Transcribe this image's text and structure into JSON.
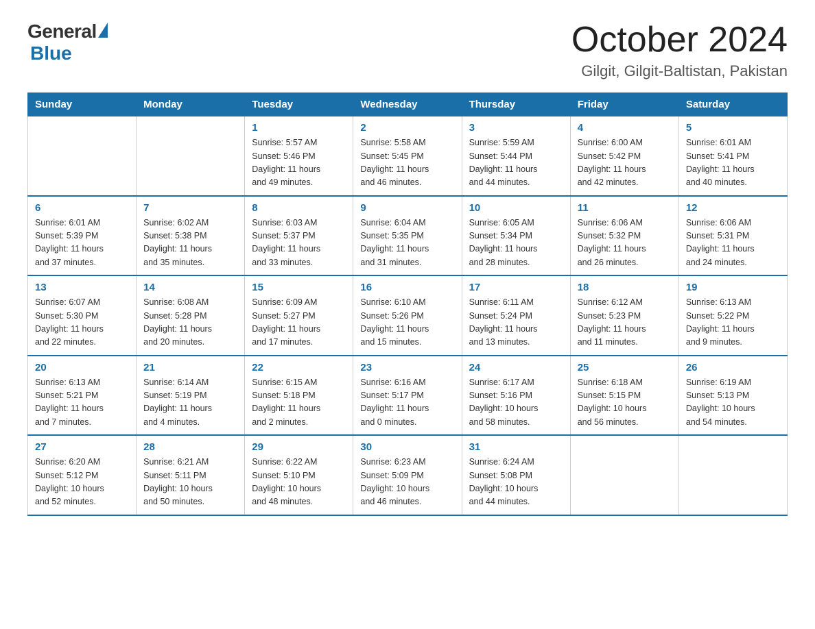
{
  "header": {
    "logo_general": "General",
    "logo_blue": "Blue",
    "month": "October 2024",
    "location": "Gilgit, Gilgit-Baltistan, Pakistan"
  },
  "days_of_week": [
    "Sunday",
    "Monday",
    "Tuesday",
    "Wednesday",
    "Thursday",
    "Friday",
    "Saturday"
  ],
  "weeks": [
    [
      {
        "day": "",
        "info": ""
      },
      {
        "day": "",
        "info": ""
      },
      {
        "day": "1",
        "info": "Sunrise: 5:57 AM\nSunset: 5:46 PM\nDaylight: 11 hours\nand 49 minutes."
      },
      {
        "day": "2",
        "info": "Sunrise: 5:58 AM\nSunset: 5:45 PM\nDaylight: 11 hours\nand 46 minutes."
      },
      {
        "day": "3",
        "info": "Sunrise: 5:59 AM\nSunset: 5:44 PM\nDaylight: 11 hours\nand 44 minutes."
      },
      {
        "day": "4",
        "info": "Sunrise: 6:00 AM\nSunset: 5:42 PM\nDaylight: 11 hours\nand 42 minutes."
      },
      {
        "day": "5",
        "info": "Sunrise: 6:01 AM\nSunset: 5:41 PM\nDaylight: 11 hours\nand 40 minutes."
      }
    ],
    [
      {
        "day": "6",
        "info": "Sunrise: 6:01 AM\nSunset: 5:39 PM\nDaylight: 11 hours\nand 37 minutes."
      },
      {
        "day": "7",
        "info": "Sunrise: 6:02 AM\nSunset: 5:38 PM\nDaylight: 11 hours\nand 35 minutes."
      },
      {
        "day": "8",
        "info": "Sunrise: 6:03 AM\nSunset: 5:37 PM\nDaylight: 11 hours\nand 33 minutes."
      },
      {
        "day": "9",
        "info": "Sunrise: 6:04 AM\nSunset: 5:35 PM\nDaylight: 11 hours\nand 31 minutes."
      },
      {
        "day": "10",
        "info": "Sunrise: 6:05 AM\nSunset: 5:34 PM\nDaylight: 11 hours\nand 28 minutes."
      },
      {
        "day": "11",
        "info": "Sunrise: 6:06 AM\nSunset: 5:32 PM\nDaylight: 11 hours\nand 26 minutes."
      },
      {
        "day": "12",
        "info": "Sunrise: 6:06 AM\nSunset: 5:31 PM\nDaylight: 11 hours\nand 24 minutes."
      }
    ],
    [
      {
        "day": "13",
        "info": "Sunrise: 6:07 AM\nSunset: 5:30 PM\nDaylight: 11 hours\nand 22 minutes."
      },
      {
        "day": "14",
        "info": "Sunrise: 6:08 AM\nSunset: 5:28 PM\nDaylight: 11 hours\nand 20 minutes."
      },
      {
        "day": "15",
        "info": "Sunrise: 6:09 AM\nSunset: 5:27 PM\nDaylight: 11 hours\nand 17 minutes."
      },
      {
        "day": "16",
        "info": "Sunrise: 6:10 AM\nSunset: 5:26 PM\nDaylight: 11 hours\nand 15 minutes."
      },
      {
        "day": "17",
        "info": "Sunrise: 6:11 AM\nSunset: 5:24 PM\nDaylight: 11 hours\nand 13 minutes."
      },
      {
        "day": "18",
        "info": "Sunrise: 6:12 AM\nSunset: 5:23 PM\nDaylight: 11 hours\nand 11 minutes."
      },
      {
        "day": "19",
        "info": "Sunrise: 6:13 AM\nSunset: 5:22 PM\nDaylight: 11 hours\nand 9 minutes."
      }
    ],
    [
      {
        "day": "20",
        "info": "Sunrise: 6:13 AM\nSunset: 5:21 PM\nDaylight: 11 hours\nand 7 minutes."
      },
      {
        "day": "21",
        "info": "Sunrise: 6:14 AM\nSunset: 5:19 PM\nDaylight: 11 hours\nand 4 minutes."
      },
      {
        "day": "22",
        "info": "Sunrise: 6:15 AM\nSunset: 5:18 PM\nDaylight: 11 hours\nand 2 minutes."
      },
      {
        "day": "23",
        "info": "Sunrise: 6:16 AM\nSunset: 5:17 PM\nDaylight: 11 hours\nand 0 minutes."
      },
      {
        "day": "24",
        "info": "Sunrise: 6:17 AM\nSunset: 5:16 PM\nDaylight: 10 hours\nand 58 minutes."
      },
      {
        "day": "25",
        "info": "Sunrise: 6:18 AM\nSunset: 5:15 PM\nDaylight: 10 hours\nand 56 minutes."
      },
      {
        "day": "26",
        "info": "Sunrise: 6:19 AM\nSunset: 5:13 PM\nDaylight: 10 hours\nand 54 minutes."
      }
    ],
    [
      {
        "day": "27",
        "info": "Sunrise: 6:20 AM\nSunset: 5:12 PM\nDaylight: 10 hours\nand 52 minutes."
      },
      {
        "day": "28",
        "info": "Sunrise: 6:21 AM\nSunset: 5:11 PM\nDaylight: 10 hours\nand 50 minutes."
      },
      {
        "day": "29",
        "info": "Sunrise: 6:22 AM\nSunset: 5:10 PM\nDaylight: 10 hours\nand 48 minutes."
      },
      {
        "day": "30",
        "info": "Sunrise: 6:23 AM\nSunset: 5:09 PM\nDaylight: 10 hours\nand 46 minutes."
      },
      {
        "day": "31",
        "info": "Sunrise: 6:24 AM\nSunset: 5:08 PM\nDaylight: 10 hours\nand 44 minutes."
      },
      {
        "day": "",
        "info": ""
      },
      {
        "day": "",
        "info": ""
      }
    ]
  ]
}
